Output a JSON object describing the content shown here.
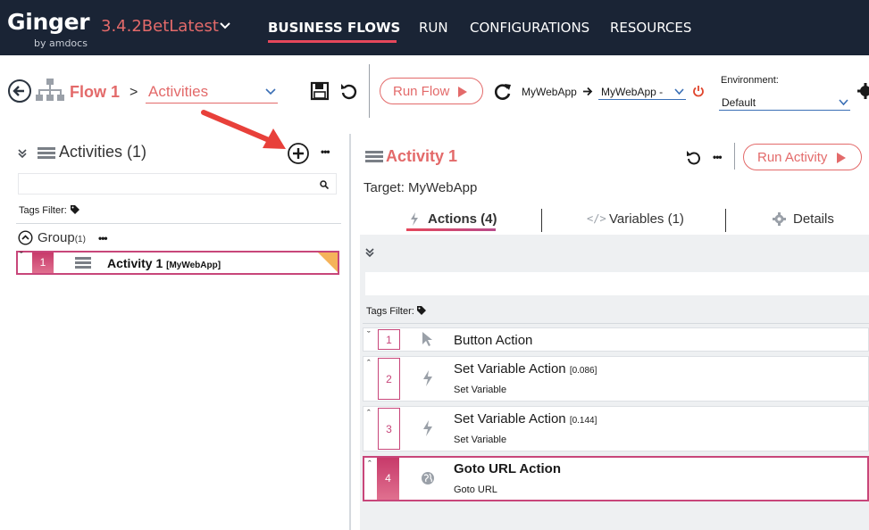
{
  "app": {
    "logo": "Ginger",
    "logo_sub": "by amdocs",
    "version": "3.4.2BetLatest"
  },
  "nav": {
    "items": [
      "BUSINESS FLOWS",
      "RUN",
      "CONFIGURATIONS",
      "RESOURCES"
    ],
    "active": "BUSINESS FLOWS"
  },
  "toolbar": {
    "flow_title": "Flow 1",
    "breadcrumb_sep": ">",
    "section_select": "Activities",
    "run_flow_label": "Run Flow",
    "target_app_label": "MyWebApp",
    "target_app_select": "MyWebApp -",
    "environment_label": "Environment:",
    "environment_value": "Default"
  },
  "left_panel": {
    "title": "Activities  (1)",
    "search_placeholder": "",
    "tags_filter_label": "Tags Filter:",
    "group": {
      "name": "Group",
      "count": "(1)",
      "more": "•••"
    },
    "activity": {
      "number": "1",
      "name": "Activity 1",
      "app": "[MyWebApp]"
    },
    "more": "•••"
  },
  "right_panel": {
    "title": "Activity 1",
    "target": "Target: MyWebApp",
    "run_activity_label": "Run Activity",
    "more": "•••",
    "tabs": [
      {
        "label": "Actions (4)",
        "icon": "lightning-icon"
      },
      {
        "label": "Variables (1)",
        "icon": "code-icon"
      },
      {
        "label": "Details",
        "icon": "gear-icon"
      }
    ],
    "tags_filter_label": "Tags Filter:",
    "actions": [
      {
        "number": "1",
        "title": "Button Action",
        "time": "",
        "subtitle": "",
        "icon": "cursor-icon",
        "caret": "ˇ"
      },
      {
        "number": "2",
        "title": "Set Variable Action",
        "time": "[0.086]",
        "subtitle": "Set Variable",
        "icon": "lightning-icon",
        "caret": "ˆ"
      },
      {
        "number": "3",
        "title": "Set Variable Action",
        "time": "[0.144]",
        "subtitle": "Set Variable",
        "icon": "lightning-icon",
        "caret": "ˆ"
      },
      {
        "number": "4",
        "title": "Goto URL Action",
        "time": "",
        "subtitle": "Goto URL",
        "icon": "globe-icon",
        "caret": "ˆ"
      }
    ]
  },
  "colors": {
    "nav_bg": "#1a2435",
    "accent": "#e36a6a",
    "highlight": "#c8467a",
    "warning_corner": "#f5b35a",
    "annotation_arrow": "#e8403a"
  }
}
